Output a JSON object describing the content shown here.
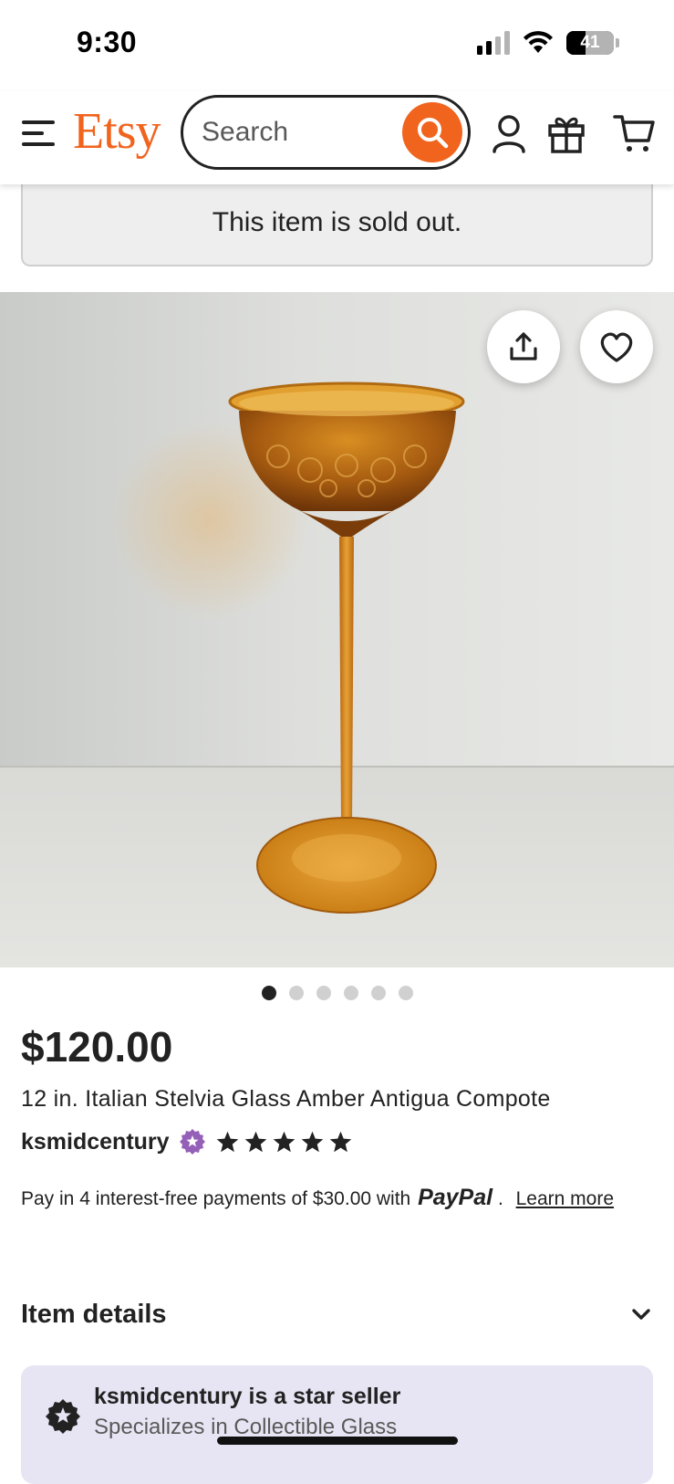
{
  "status_bar": {
    "time": "9:30",
    "battery": "41",
    "battery_level": 0.41
  },
  "header": {
    "logo": "Etsy",
    "search_placeholder": "Search",
    "icons": [
      "menu-icon",
      "search-icon",
      "account-icon",
      "gift-icon",
      "cart-icon"
    ]
  },
  "notice": {
    "sold_out": "This item is sold out."
  },
  "gallery": {
    "image_count": 6,
    "active_index": 0,
    "actions": [
      "share-icon",
      "favorite-heart-icon"
    ]
  },
  "listing": {
    "price": "$120.00",
    "title": "12 in. Italian Stelvia Glass Amber Antigua Compote",
    "seller": "ksmidcentury",
    "rating_stars": 5,
    "paypal_text": "Pay in 4 interest-free payments of $30.00 with",
    "paypal_brand": "PayPal",
    "paypal_sep": ".",
    "learn_more": "Learn more"
  },
  "sections": {
    "item_details": "Item details"
  },
  "star_seller": {
    "title": "ksmidcentury is a star seller",
    "subtitle": "Specializes in Collectible Glass"
  },
  "colors": {
    "brand": "#F1641E",
    "star_seller_bg": "#E7E5F3",
    "star_badge": "#9560B8"
  }
}
